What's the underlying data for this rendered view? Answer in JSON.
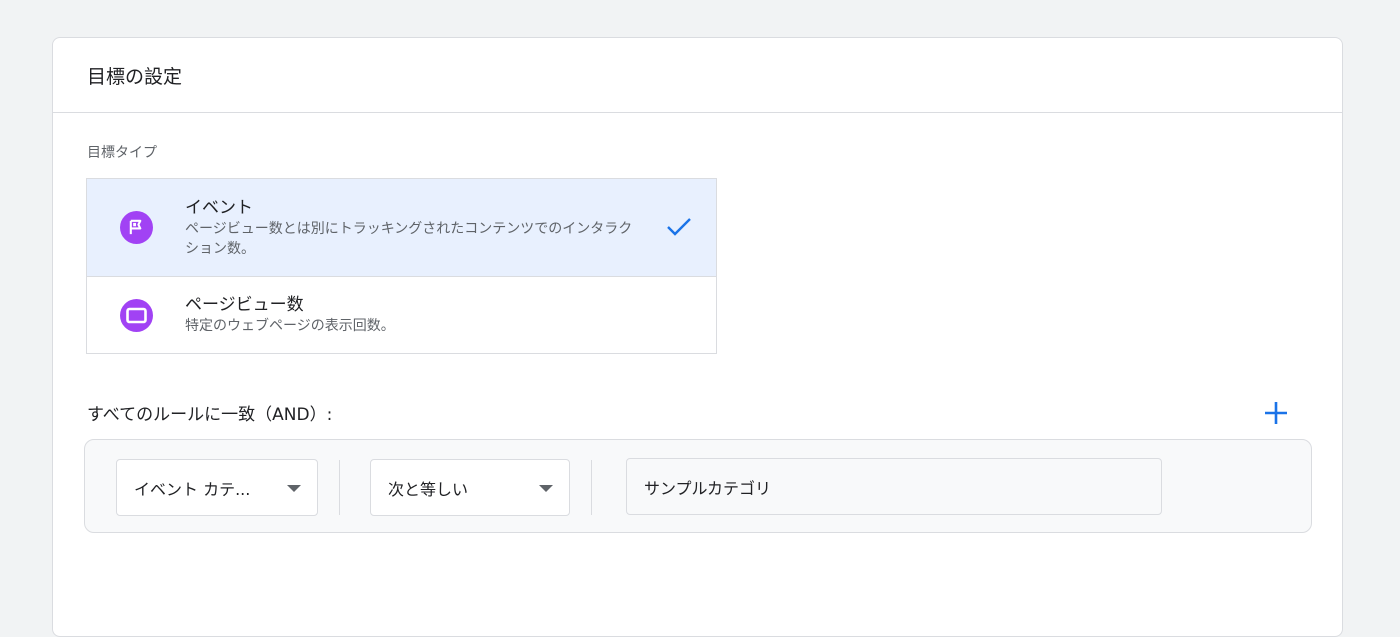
{
  "card": {
    "title": "目標の設定"
  },
  "goal_type": {
    "label": "目標タイプ",
    "options": [
      {
        "name": "イベント",
        "description": "ページビュー数とは別にトラッキングされたコンテンツでのインタラクション数。",
        "icon": "flag-icon",
        "selected": true
      },
      {
        "name": "ページビュー数",
        "description": "特定のウェブページの表示回数。",
        "icon": "browser-window-icon",
        "selected": false
      }
    ]
  },
  "rules": {
    "label": "すべてのルールに一致（AND）:",
    "add_icon": "plus-icon",
    "rule": {
      "dimension": "イベント カテ...",
      "operator": "次と等しい",
      "value": "サンプルカテゴリ"
    }
  },
  "colors": {
    "accent": "#1a73e8",
    "icon_purple": "#a142f4",
    "selected_bg": "#e8f0fe"
  }
}
